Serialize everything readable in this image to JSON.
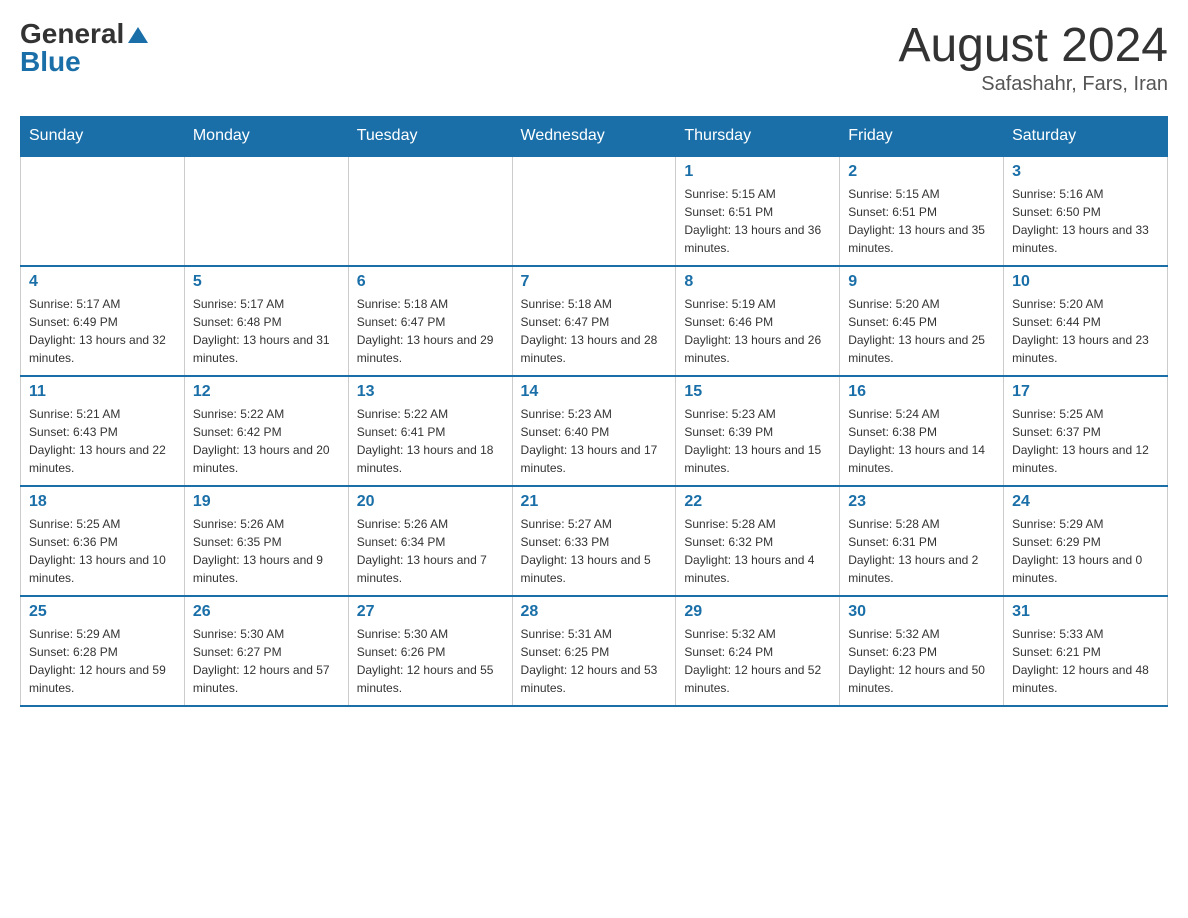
{
  "header": {
    "logo_general": "General",
    "logo_blue": "Blue",
    "month_year": "August 2024",
    "location": "Safashahr, Fars, Iran"
  },
  "calendar": {
    "days_of_week": [
      "Sunday",
      "Monday",
      "Tuesday",
      "Wednesday",
      "Thursday",
      "Friday",
      "Saturday"
    ],
    "weeks": [
      [
        {
          "day": "",
          "info": ""
        },
        {
          "day": "",
          "info": ""
        },
        {
          "day": "",
          "info": ""
        },
        {
          "day": "",
          "info": ""
        },
        {
          "day": "1",
          "info": "Sunrise: 5:15 AM\nSunset: 6:51 PM\nDaylight: 13 hours and 36 minutes."
        },
        {
          "day": "2",
          "info": "Sunrise: 5:15 AM\nSunset: 6:51 PM\nDaylight: 13 hours and 35 minutes."
        },
        {
          "day": "3",
          "info": "Sunrise: 5:16 AM\nSunset: 6:50 PM\nDaylight: 13 hours and 33 minutes."
        }
      ],
      [
        {
          "day": "4",
          "info": "Sunrise: 5:17 AM\nSunset: 6:49 PM\nDaylight: 13 hours and 32 minutes."
        },
        {
          "day": "5",
          "info": "Sunrise: 5:17 AM\nSunset: 6:48 PM\nDaylight: 13 hours and 31 minutes."
        },
        {
          "day": "6",
          "info": "Sunrise: 5:18 AM\nSunset: 6:47 PM\nDaylight: 13 hours and 29 minutes."
        },
        {
          "day": "7",
          "info": "Sunrise: 5:18 AM\nSunset: 6:47 PM\nDaylight: 13 hours and 28 minutes."
        },
        {
          "day": "8",
          "info": "Sunrise: 5:19 AM\nSunset: 6:46 PM\nDaylight: 13 hours and 26 minutes."
        },
        {
          "day": "9",
          "info": "Sunrise: 5:20 AM\nSunset: 6:45 PM\nDaylight: 13 hours and 25 minutes."
        },
        {
          "day": "10",
          "info": "Sunrise: 5:20 AM\nSunset: 6:44 PM\nDaylight: 13 hours and 23 minutes."
        }
      ],
      [
        {
          "day": "11",
          "info": "Sunrise: 5:21 AM\nSunset: 6:43 PM\nDaylight: 13 hours and 22 minutes."
        },
        {
          "day": "12",
          "info": "Sunrise: 5:22 AM\nSunset: 6:42 PM\nDaylight: 13 hours and 20 minutes."
        },
        {
          "day": "13",
          "info": "Sunrise: 5:22 AM\nSunset: 6:41 PM\nDaylight: 13 hours and 18 minutes."
        },
        {
          "day": "14",
          "info": "Sunrise: 5:23 AM\nSunset: 6:40 PM\nDaylight: 13 hours and 17 minutes."
        },
        {
          "day": "15",
          "info": "Sunrise: 5:23 AM\nSunset: 6:39 PM\nDaylight: 13 hours and 15 minutes."
        },
        {
          "day": "16",
          "info": "Sunrise: 5:24 AM\nSunset: 6:38 PM\nDaylight: 13 hours and 14 minutes."
        },
        {
          "day": "17",
          "info": "Sunrise: 5:25 AM\nSunset: 6:37 PM\nDaylight: 13 hours and 12 minutes."
        }
      ],
      [
        {
          "day": "18",
          "info": "Sunrise: 5:25 AM\nSunset: 6:36 PM\nDaylight: 13 hours and 10 minutes."
        },
        {
          "day": "19",
          "info": "Sunrise: 5:26 AM\nSunset: 6:35 PM\nDaylight: 13 hours and 9 minutes."
        },
        {
          "day": "20",
          "info": "Sunrise: 5:26 AM\nSunset: 6:34 PM\nDaylight: 13 hours and 7 minutes."
        },
        {
          "day": "21",
          "info": "Sunrise: 5:27 AM\nSunset: 6:33 PM\nDaylight: 13 hours and 5 minutes."
        },
        {
          "day": "22",
          "info": "Sunrise: 5:28 AM\nSunset: 6:32 PM\nDaylight: 13 hours and 4 minutes."
        },
        {
          "day": "23",
          "info": "Sunrise: 5:28 AM\nSunset: 6:31 PM\nDaylight: 13 hours and 2 minutes."
        },
        {
          "day": "24",
          "info": "Sunrise: 5:29 AM\nSunset: 6:29 PM\nDaylight: 13 hours and 0 minutes."
        }
      ],
      [
        {
          "day": "25",
          "info": "Sunrise: 5:29 AM\nSunset: 6:28 PM\nDaylight: 12 hours and 59 minutes."
        },
        {
          "day": "26",
          "info": "Sunrise: 5:30 AM\nSunset: 6:27 PM\nDaylight: 12 hours and 57 minutes."
        },
        {
          "day": "27",
          "info": "Sunrise: 5:30 AM\nSunset: 6:26 PM\nDaylight: 12 hours and 55 minutes."
        },
        {
          "day": "28",
          "info": "Sunrise: 5:31 AM\nSunset: 6:25 PM\nDaylight: 12 hours and 53 minutes."
        },
        {
          "day": "29",
          "info": "Sunrise: 5:32 AM\nSunset: 6:24 PM\nDaylight: 12 hours and 52 minutes."
        },
        {
          "day": "30",
          "info": "Sunrise: 5:32 AM\nSunset: 6:23 PM\nDaylight: 12 hours and 50 minutes."
        },
        {
          "day": "31",
          "info": "Sunrise: 5:33 AM\nSunset: 6:21 PM\nDaylight: 12 hours and 48 minutes."
        }
      ]
    ]
  }
}
